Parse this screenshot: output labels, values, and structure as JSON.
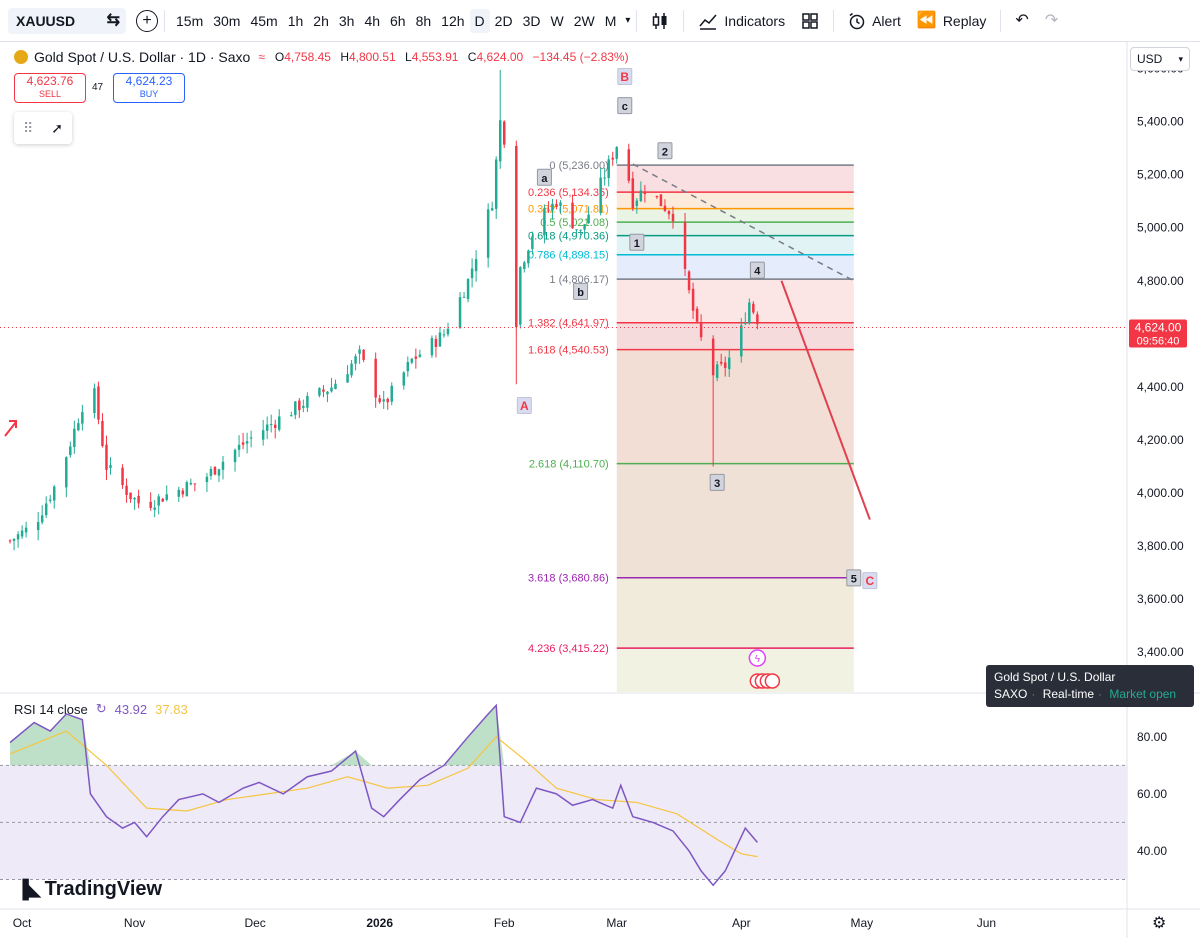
{
  "toolbar": {
    "symbol": "XAUUSD",
    "timeframes": [
      "15m",
      "30m",
      "45m",
      "1h",
      "2h",
      "3h",
      "4h",
      "6h",
      "8h",
      "12h",
      "D",
      "2D",
      "3D",
      "W",
      "2W",
      "M"
    ],
    "active_timeframe": "D",
    "indicators_label": "Indicators",
    "alert_label": "Alert",
    "replay_label": "Replay"
  },
  "legend": {
    "title": "Gold Spot / U.S. Dollar · 1D · Saxo",
    "o_label": "O",
    "o": "4,758.45",
    "h_label": "H",
    "h": "4,800.51",
    "l_label": "L",
    "l": "4,553.91",
    "c_label": "C",
    "c": "4,624.00",
    "change": "−134.45 (−2.83%)"
  },
  "trade": {
    "sell_price": "4,623.76",
    "sell_label": "SELL",
    "buy_price": "4,624.23",
    "buy_label": "BUY",
    "spread": "47"
  },
  "currency": "USD",
  "price_tag": {
    "price": "4,624.00",
    "countdown": "09:56:40"
  },
  "tooltip": {
    "title": "Gold Spot / U.S. Dollar",
    "source": "SAXO",
    "mode": "Real-time",
    "status": "Market open"
  },
  "rsi_legend": {
    "label": "RSI 14 close",
    "rsi": "43.92",
    "ma": "37.83"
  },
  "brand": "TradingView",
  "colors": {
    "up": "#22ab94",
    "down": "#f23645",
    "rsi": "#7e57c2",
    "rsi_ma": "#f5c542"
  },
  "chart_data": {
    "type": "candlestick",
    "symbol": "XAUUSD",
    "y_ticks": [
      "5,600.00",
      "5,400.00",
      "5,200.00",
      "5,000.00",
      "4,800.00",
      "4,600.00",
      "4,400.00",
      "4,200.00",
      "4,000.00",
      "3,800.00",
      "3,600.00",
      "3,400.00"
    ],
    "ylim": [
      3250,
      5700
    ],
    "x_ticks": [
      {
        "label": "Oct",
        "day": 0
      },
      {
        "label": "Nov",
        "day": 31
      },
      {
        "label": "Dec",
        "day": 61
      },
      {
        "label": "2026",
        "day": 92
      },
      {
        "label": "Feb",
        "day": 123
      },
      {
        "label": "Mar",
        "day": 151
      },
      {
        "label": "Apr",
        "day": 182
      },
      {
        "label": "May",
        "day": 212
      },
      {
        "label": "Jun",
        "day": 243
      }
    ],
    "xlim": [
      -2.5,
      278
    ],
    "price_path": [
      [
        0,
        3820
      ],
      [
        6,
        3880
      ],
      [
        12,
        4050
      ],
      [
        18,
        4330
      ],
      [
        21,
        4370
      ],
      [
        24,
        4100
      ],
      [
        30,
        3990
      ],
      [
        33,
        3950
      ],
      [
        40,
        4000
      ],
      [
        48,
        4050
      ],
      [
        55,
        4150
      ],
      [
        62,
        4230
      ],
      [
        72,
        4330
      ],
      [
        80,
        4400
      ],
      [
        87,
        4520
      ],
      [
        91,
        4380
      ],
      [
        93,
        4330
      ],
      [
        100,
        4500
      ],
      [
        108,
        4600
      ],
      [
        114,
        4800
      ],
      [
        120,
        5100
      ],
      [
        122,
        5400
      ],
      [
        124,
        5280
      ],
      [
        125,
        4900
      ],
      [
        126,
        4650
      ],
      [
        127,
        4850
      ],
      [
        131,
        5020
      ],
      [
        136,
        5100
      ],
      [
        142,
        4980
      ],
      [
        148,
        5200
      ],
      [
        152,
        5350
      ],
      [
        155,
        5100
      ],
      [
        158,
        5150
      ],
      [
        165,
        5050
      ],
      [
        168,
        4820
      ],
      [
        171,
        4620
      ],
      [
        175,
        4450
      ],
      [
        178,
        4480
      ],
      [
        181,
        4560
      ],
      [
        184,
        4720
      ],
      [
        187,
        4624
      ]
    ],
    "fib_levels": [
      {
        "label": "0 (5,236.00)",
        "price": 5236.0,
        "color": "#787b86"
      },
      {
        "label": "0.236 (5,134.35)",
        "price": 5134.35,
        "color": "#f23645"
      },
      {
        "label": "0.382 (5,071.81)",
        "price": 5071.81,
        "color": "#ff9800"
      },
      {
        "label": "0.5 (5,021.08)",
        "price": 5021.08,
        "color": "#4caf50"
      },
      {
        "label": "0.618 (4,970.36)",
        "price": 4970.36,
        "color": "#089981"
      },
      {
        "label": "0.786 (4,898.15)",
        "price": 4898.15,
        "color": "#00bcd4"
      },
      {
        "label": "1 (4,806.17)",
        "price": 4806.17,
        "color": "#787b86"
      },
      {
        "label": "1.382 (4,641.97)",
        "price": 4641.97,
        "color": "#f23645"
      },
      {
        "label": "1.618 (4,540.53)",
        "price": 4540.53,
        "color": "#f23645"
      },
      {
        "label": "2.618 (4,110.70)",
        "price": 4110.7,
        "color": "#4caf50"
      },
      {
        "label": "3.618 (3,680.86)",
        "price": 3680.86,
        "color": "#9c27b0"
      },
      {
        "label": "4.236 (3,415.22)",
        "price": 3415.22,
        "color": "#e91e63"
      }
    ],
    "fib_range_days": [
      151,
      210
    ],
    "wave_labels": [
      {
        "text": "A",
        "day": 128,
        "price": 4330,
        "style": "major"
      },
      {
        "text": "B",
        "day": 153,
        "price": 5570,
        "style": "major"
      },
      {
        "text": "C",
        "day": 214,
        "price": 3670,
        "style": "major"
      },
      {
        "text": "a",
        "day": 133,
        "price": 5190,
        "style": "minor"
      },
      {
        "text": "b",
        "day": 142,
        "price": 4760,
        "style": "minor"
      },
      {
        "text": "c",
        "day": 153,
        "price": 5460,
        "style": "minor"
      },
      {
        "text": "1",
        "day": 156,
        "price": 4945,
        "style": "minor"
      },
      {
        "text": "2",
        "day": 163,
        "price": 5290,
        "style": "minor"
      },
      {
        "text": "3",
        "day": 176,
        "price": 4040,
        "style": "minor"
      },
      {
        "text": "4",
        "day": 186,
        "price": 4840,
        "style": "minor"
      },
      {
        "text": "5",
        "day": 210,
        "price": 3680,
        "style": "minor"
      }
    ],
    "projection": {
      "from": [
        192,
        4800
      ],
      "to": [
        214,
        3900
      ]
    },
    "trend_line": {
      "from": [
        155,
        5240
      ],
      "to": [
        210,
        4800
      ]
    },
    "current_price": 4624.0,
    "rsi": {
      "ylim": [
        20,
        95
      ],
      "y_ticks": [
        "80.00",
        "60.00",
        "40.00"
      ],
      "overbought": 70,
      "middle": 50,
      "oversold": 30,
      "values": [
        [
          0,
          78
        ],
        [
          6,
          85
        ],
        [
          10,
          82
        ],
        [
          14,
          88
        ],
        [
          18,
          86
        ],
        [
          20,
          60
        ],
        [
          24,
          52
        ],
        [
          28,
          48
        ],
        [
          31,
          50
        ],
        [
          34,
          45
        ],
        [
          38,
          52
        ],
        [
          42,
          58
        ],
        [
          48,
          60
        ],
        [
          52,
          57
        ],
        [
          58,
          62
        ],
        [
          62,
          64
        ],
        [
          68,
          60
        ],
        [
          74,
          66
        ],
        [
          80,
          68
        ],
        [
          86,
          75
        ],
        [
          90,
          55
        ],
        [
          93,
          52
        ],
        [
          97,
          58
        ],
        [
          102,
          65
        ],
        [
          108,
          70
        ],
        [
          114,
          80
        ],
        [
          119,
          88
        ],
        [
          121,
          91
        ],
        [
          123,
          52
        ],
        [
          127,
          50
        ],
        [
          131,
          62
        ],
        [
          136,
          60
        ],
        [
          140,
          56
        ],
        [
          145,
          58
        ],
        [
          150,
          55
        ],
        [
          152,
          63
        ],
        [
          155,
          52
        ],
        [
          160,
          50
        ],
        [
          165,
          47
        ],
        [
          169,
          40
        ],
        [
          172,
          33
        ],
        [
          175,
          28
        ],
        [
          178,
          33
        ],
        [
          181,
          42
        ],
        [
          183,
          48
        ],
        [
          186,
          43
        ]
      ],
      "ma_values": [
        [
          0,
          74
        ],
        [
          14,
          82
        ],
        [
          24,
          70
        ],
        [
          34,
          55
        ],
        [
          44,
          54
        ],
        [
          54,
          58
        ],
        [
          64,
          60
        ],
        [
          74,
          62
        ],
        [
          84,
          66
        ],
        [
          94,
          62
        ],
        [
          104,
          63
        ],
        [
          114,
          69
        ],
        [
          121,
          80
        ],
        [
          128,
          72
        ],
        [
          136,
          62
        ],
        [
          146,
          58
        ],
        [
          156,
          57
        ],
        [
          166,
          53
        ],
        [
          176,
          44
        ],
        [
          182,
          39
        ],
        [
          186,
          38
        ]
      ]
    }
  }
}
